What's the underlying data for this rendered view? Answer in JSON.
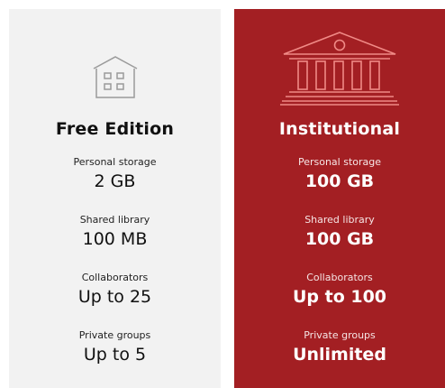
{
  "plans": [
    {
      "icon": "house-icon",
      "title": "Free Edition",
      "features": [
        {
          "label": "Personal storage",
          "value": "2 GB"
        },
        {
          "label": "Shared library",
          "value": "100 MB"
        },
        {
          "label": "Collaborators",
          "value": "Up to 25"
        },
        {
          "label": "Private groups",
          "value": "Up to 5"
        }
      ]
    },
    {
      "icon": "institution-building-icon",
      "title": "Institutional",
      "features": [
        {
          "label": "Personal storage",
          "value": "100 GB"
        },
        {
          "label": "Shared library",
          "value": "100 GB"
        },
        {
          "label": "Collaborators",
          "value": "Up to 100"
        },
        {
          "label": "Private groups",
          "value": "Unlimited"
        }
      ]
    }
  ],
  "colors": {
    "free_background": "#f2f2f2",
    "institutional_background": "#a31f23",
    "institutional_icon_stroke": "#f08a86"
  }
}
